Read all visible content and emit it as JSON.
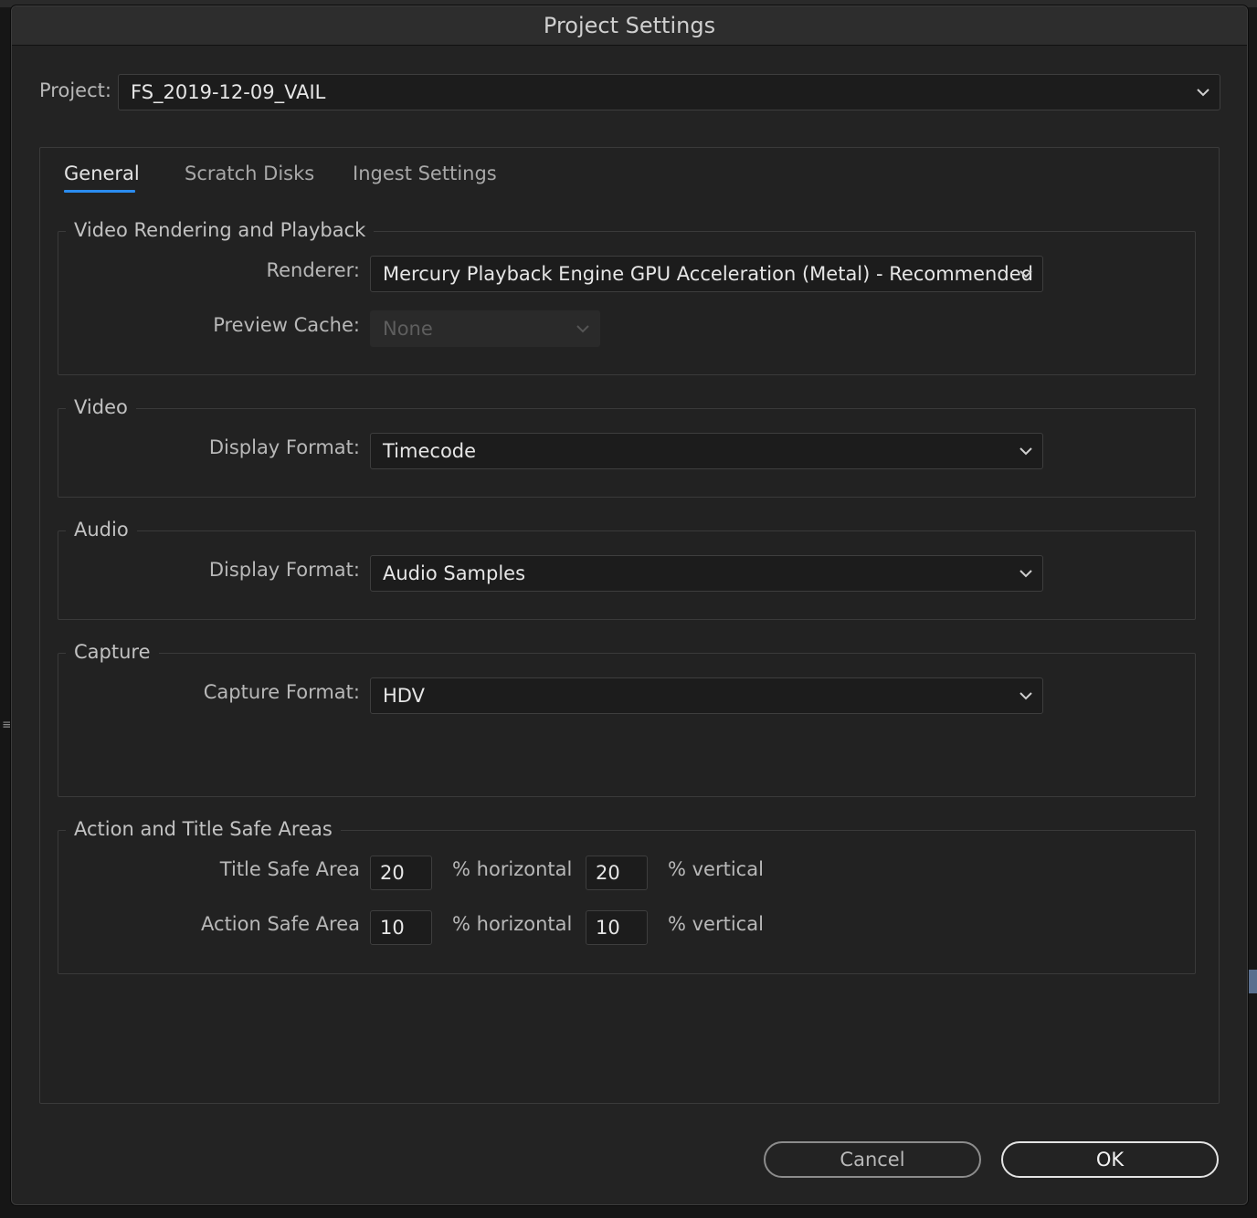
{
  "window": {
    "title": "Project Settings"
  },
  "project": {
    "label": "Project:",
    "value": "FS_2019-12-09_VAIL"
  },
  "tabs": [
    {
      "label": "General",
      "active": true
    },
    {
      "label": "Scratch Disks",
      "active": false
    },
    {
      "label": "Ingest Settings",
      "active": false
    }
  ],
  "video_rendering": {
    "title": "Video Rendering and Playback",
    "renderer_label": "Renderer:",
    "renderer_value": "Mercury Playback Engine GPU Acceleration (Metal) - Recommended",
    "preview_cache_label": "Preview Cache:",
    "preview_cache_value": "None"
  },
  "video": {
    "title": "Video",
    "display_format_label": "Display Format:",
    "display_format_value": "Timecode"
  },
  "audio": {
    "title": "Audio",
    "display_format_label": "Display Format:",
    "display_format_value": "Audio Samples"
  },
  "capture": {
    "title": "Capture",
    "capture_format_label": "Capture Format:",
    "capture_format_value": "HDV"
  },
  "safe_areas": {
    "title": "Action and Title Safe Areas",
    "title_safe_label": "Title Safe Area",
    "title_safe_horizontal": "20",
    "title_safe_vertical": "20",
    "action_safe_label": "Action Safe Area",
    "action_safe_horizontal": "10",
    "action_safe_vertical": "10",
    "horizontal_unit": "% horizontal",
    "vertical_unit": "% vertical"
  },
  "buttons": {
    "cancel": "Cancel",
    "ok": "OK"
  },
  "colors": {
    "accent": "#2b8cf0",
    "dialog_bg": "#232323",
    "field_bg": "#1c1c1c"
  },
  "icons": {
    "dropdown": "chevron-down-icon"
  }
}
